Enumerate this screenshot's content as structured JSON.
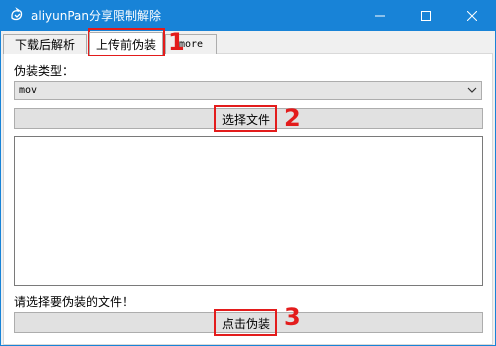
{
  "window": {
    "title": "aliyunPan分享限制解除",
    "colors": {
      "titlebar": "#1883d7",
      "highlight": "#e31c1c"
    }
  },
  "tabs": [
    {
      "label": "下载后解析"
    },
    {
      "label": "上传前伪装",
      "selected": true
    },
    {
      "label": "more"
    }
  ],
  "panel": {
    "type_label": "伪装类型：",
    "type_select": {
      "value": "mov"
    },
    "choose_file_label": "选择文件",
    "status_text": "请选择要伪装的文件！",
    "disguise_label": "点击伪装"
  },
  "annotations": [
    "1",
    "2",
    "3"
  ]
}
